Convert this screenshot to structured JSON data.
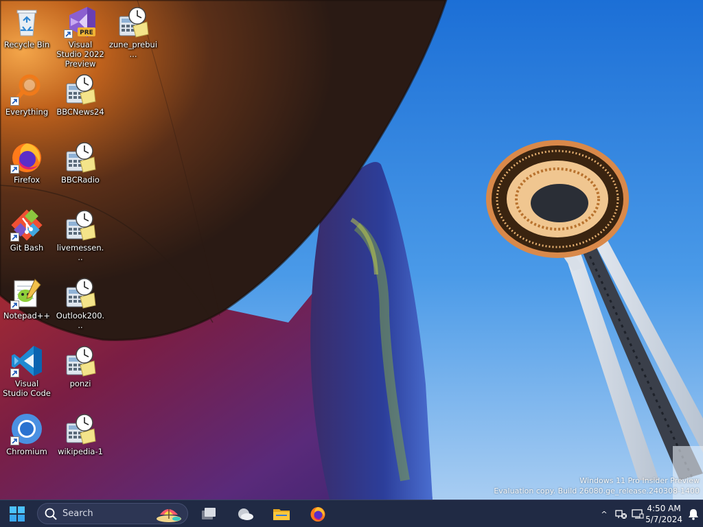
{
  "desktop": {
    "icons": [
      {
        "label": "Recycle Bin",
        "icon": "recycle-bin-icon"
      },
      {
        "label": "Visual Studio 2022 Preview",
        "icon": "visual-studio-preview-icon",
        "badge": "PRE"
      },
      {
        "label": "zune_prebui...",
        "icon": "calc-clock-icon"
      },
      {
        "label": "Everything",
        "icon": "magnifier-icon"
      },
      {
        "label": "BBCNews24",
        "icon": "calc-clock-icon"
      },
      {
        "label": "Firefox",
        "icon": "firefox-icon"
      },
      {
        "label": "BBCRadio",
        "icon": "calc-clock-icon"
      },
      {
        "label": "Git Bash",
        "icon": "git-icon"
      },
      {
        "label": "livemessen...",
        "icon": "calc-clock-icon"
      },
      {
        "label": "Notepad++",
        "icon": "notepad-plus-plus-icon"
      },
      {
        "label": "Outlook200...",
        "icon": "calc-clock-icon"
      },
      {
        "label": "Visual Studio Code",
        "icon": "vscode-icon"
      },
      {
        "label": "ponzi",
        "icon": "calc-clock-icon"
      },
      {
        "label": "Chromium",
        "icon": "chromium-icon"
      },
      {
        "label": "wikipedia-1",
        "icon": "calc-clock-icon"
      }
    ]
  },
  "watermark": {
    "line1": "Windows 11 Pro Insider Preview",
    "line2": "Evaluation copy. Build 26080.ge_release.240308-1400"
  },
  "taskbar": {
    "search_placeholder": "Search",
    "apps": [
      "start-icon",
      "task-view-icon",
      "widgets-icon",
      "file-explorer-icon",
      "firefox-icon"
    ],
    "tray": {
      "chevron": "^",
      "time": "4:50 AM",
      "date": "5/7/2024"
    }
  },
  "colors": {
    "sky": "#3a8be0",
    "taskbar": "#202a44",
    "accent": "#0078d4"
  }
}
